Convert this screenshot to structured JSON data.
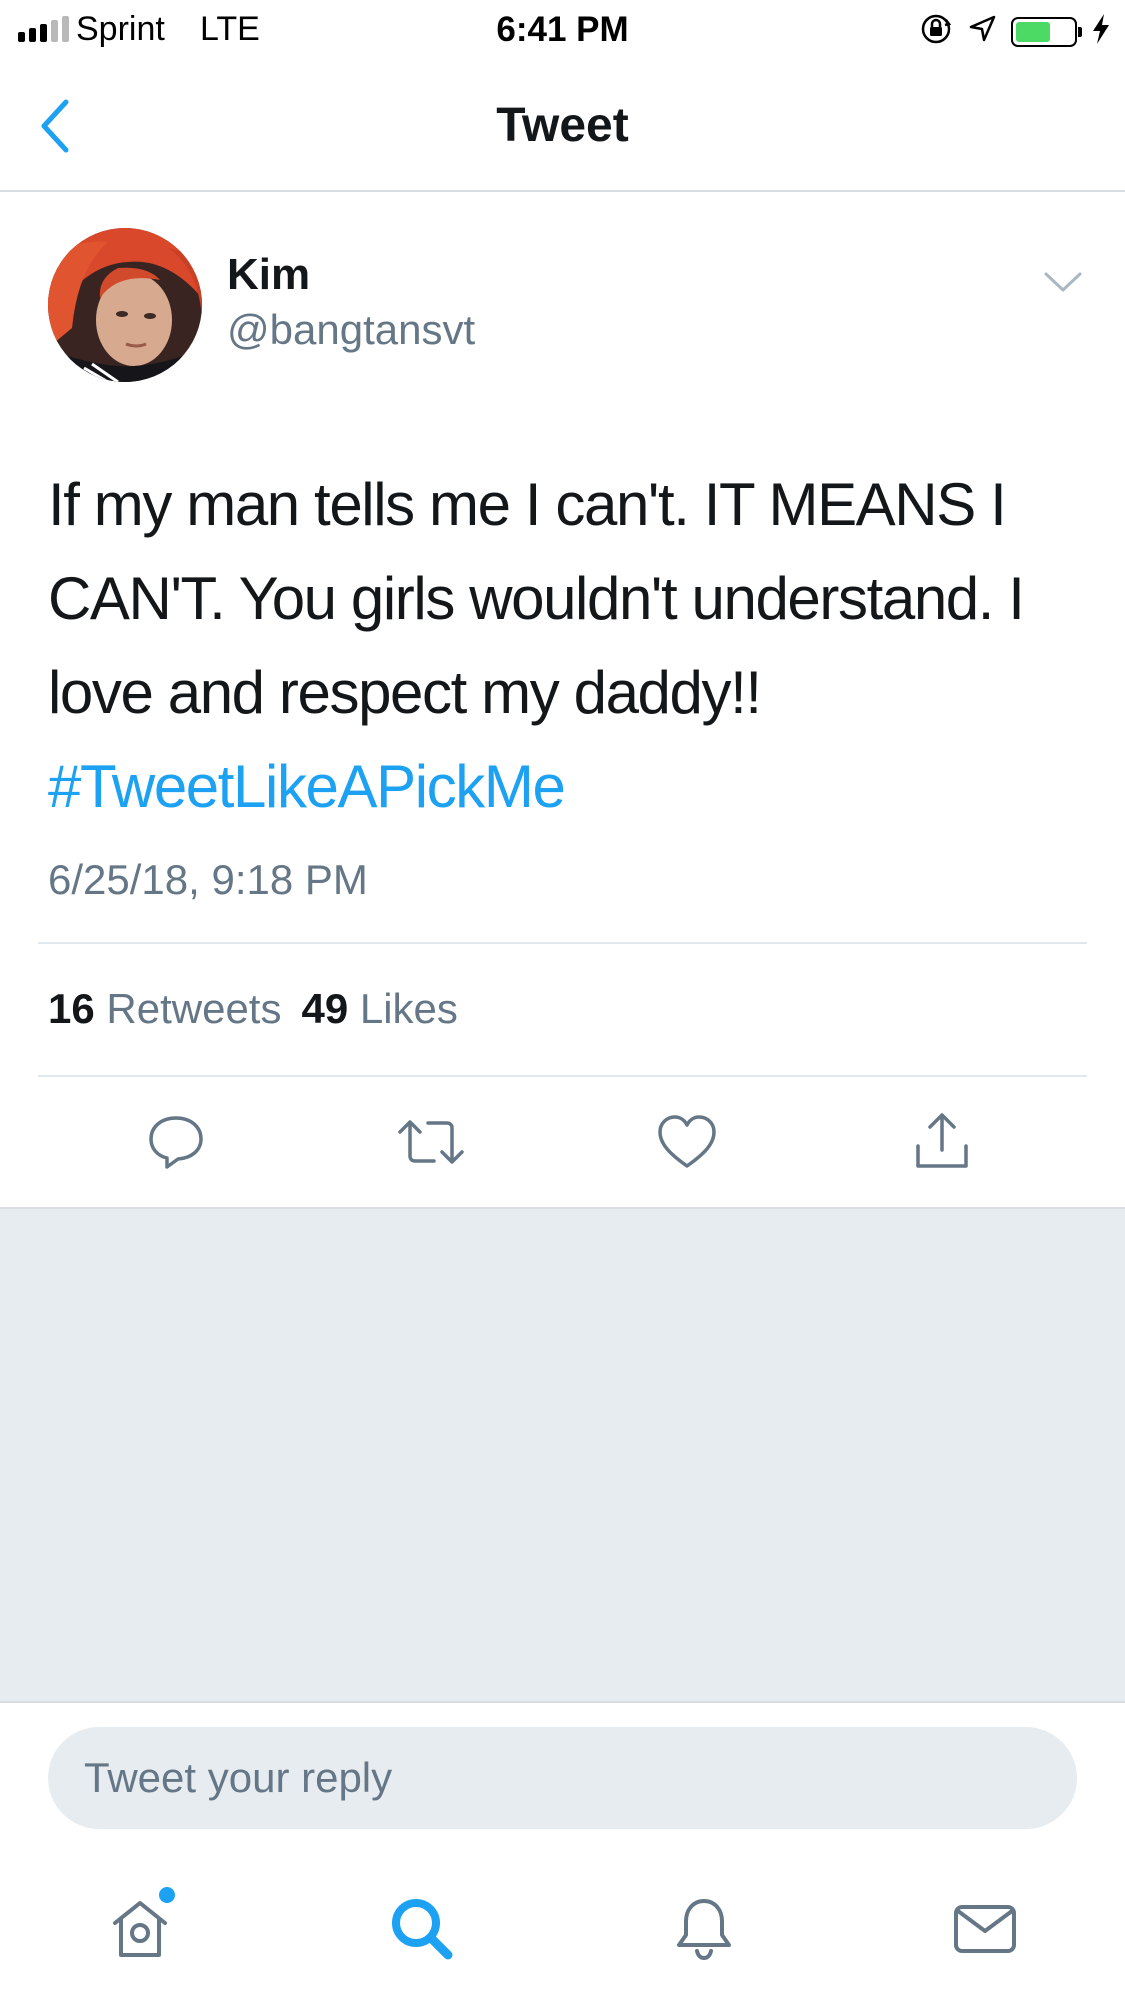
{
  "status_bar": {
    "carrier": "Sprint",
    "network": "LTE",
    "time": "6:41 PM",
    "signal_bars_filled": 3,
    "signal_bars_total": 5,
    "battery_level": 0.6,
    "icons": [
      "orientation-lock-icon",
      "location-arrow-icon",
      "battery-icon",
      "charging-bolt-icon"
    ]
  },
  "nav": {
    "title": "Tweet",
    "back_icon": "chevron-left-icon"
  },
  "tweet": {
    "author_name": "Kim",
    "author_handle": "@bangtansvt",
    "text_lines": [
      "If my man tells me I can't. IT MEANS I",
      "CAN'T. You girls wouldn't understand. I",
      "love and respect my daddy!!"
    ],
    "hashtag": "#TweetLikeAPickMe",
    "timestamp": "6/25/18, 9:18 PM",
    "retweet_count": "16",
    "retweet_label": "Retweets",
    "like_count": "49",
    "like_label": "Likes"
  },
  "actions": [
    "reply-icon",
    "retweet-icon",
    "like-icon",
    "share-icon"
  ],
  "reply": {
    "placeholder": "Tweet your reply"
  },
  "tab_bar": [
    "home-icon",
    "search-icon",
    "notifications-icon",
    "messages-icon"
  ],
  "colors": {
    "accent": "#1da1f2",
    "text": "#14171a",
    "secondary_text": "#657786",
    "divider": "#e1e8ed",
    "background_grey": "#e6ecf0",
    "battery_green": "#4cd964"
  }
}
